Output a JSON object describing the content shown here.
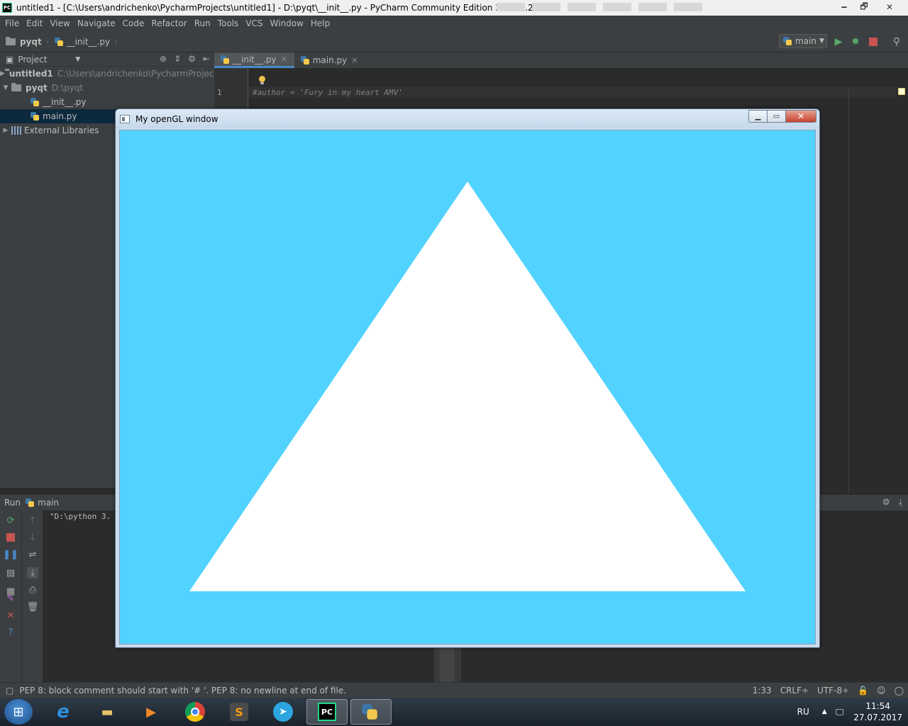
{
  "titlebar": {
    "title": "untitled1 - [C:\\Users\\andrichenko\\PycharmProjects\\untitled1] - D:\\pyqt\\__init__.py - PyCharm Community Edition 2017.1.2",
    "app_logo": "PC",
    "minimize": "🗕",
    "maximize": "🗗",
    "close": "✕"
  },
  "menu": [
    "File",
    "Edit",
    "View",
    "Navigate",
    "Code",
    "Refactor",
    "Run",
    "Tools",
    "VCS",
    "Window",
    "Help"
  ],
  "navbar": {
    "crumb1": "pyqt",
    "crumb2": "__init__.py",
    "run_config": "main"
  },
  "project": {
    "header": "Project",
    "tree": [
      {
        "label": "untitled1",
        "path": "C:\\Users\\andrichenko\\PycharmProject"
      },
      {
        "label": "pyqt",
        "path": "D:\\pyqt"
      },
      {
        "label": "__init__.py"
      },
      {
        "label": "main.py"
      },
      {
        "label": "External Libraries"
      }
    ]
  },
  "editor": {
    "tabs": [
      {
        "label": "__init__.py",
        "active": true
      },
      {
        "label": "main.py",
        "active": false
      }
    ],
    "line_number": "1",
    "code": "#author = 'Fury in my heart AMV'"
  },
  "run": {
    "label": "Run",
    "config": "main",
    "console": "\"D:\\python 3."
  },
  "status": {
    "message": "PEP 8: block comment should start with '# '. PEP 8: no newline at end of file.",
    "position": "1:33",
    "line_sep": "CRLF÷",
    "encoding": "UTF-8÷"
  },
  "taskbar": {
    "language": "RU",
    "time": "11:54",
    "date": "27.07.2017",
    "pycharm_label": "PC",
    "sublime_label": "S"
  },
  "gl_window": {
    "title": "My openGL window",
    "canvas_color": "#52d3ff",
    "shape_color": "#ffffff",
    "shape": "triangle"
  },
  "colors": {
    "ide_bg": "#2b2b2b",
    "panel_bg": "#3c3f41",
    "selection": "#0d293e",
    "accent": "#4a88c7"
  }
}
